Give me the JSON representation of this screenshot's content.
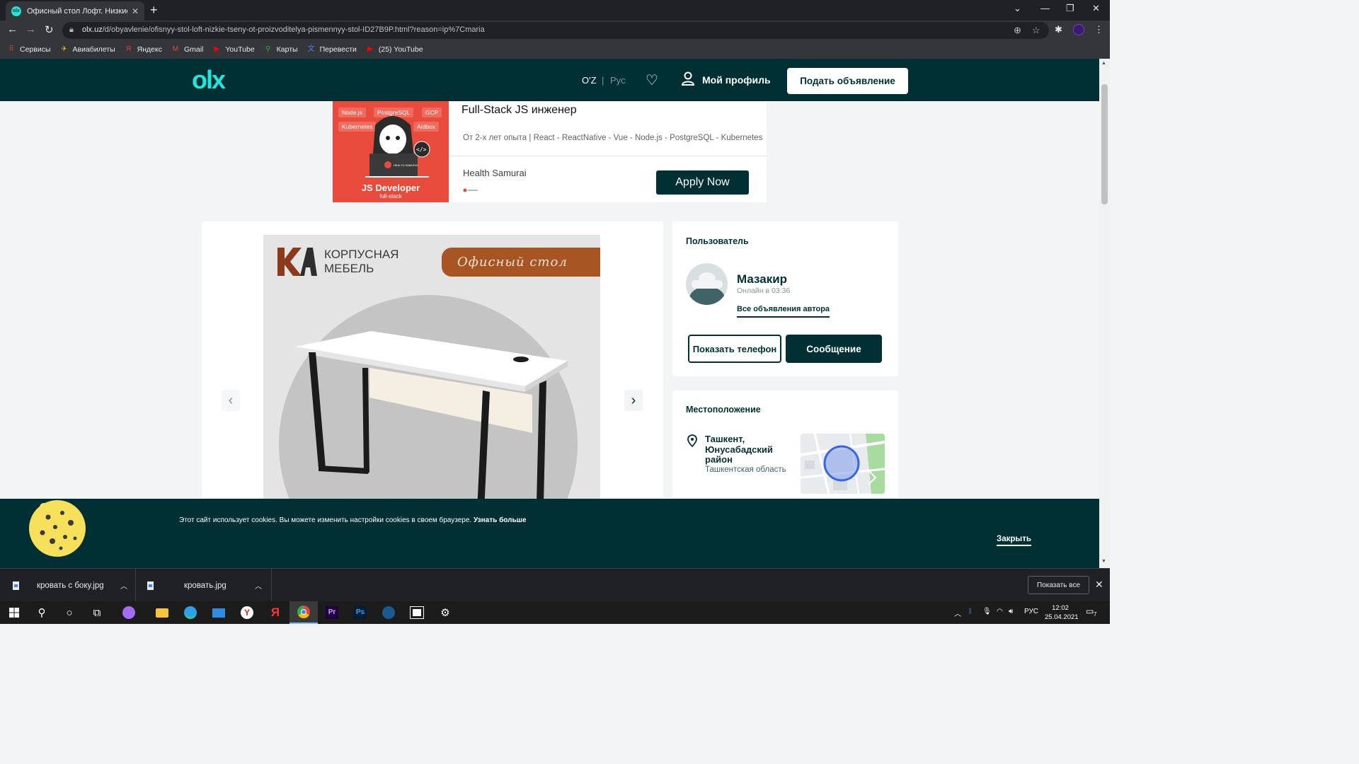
{
  "browser": {
    "tab_title": "Офисный стол Лофт. Низкие це",
    "url_host": "olx.uz",
    "url_path": "/d/obyavlenie/ofisnyy-stol-loft-nizkie-tseny-ot-proizvoditelya-pismennyy-stol-ID27B9P.html?reason=ip%7Cmaria"
  },
  "bookmarks": [
    {
      "label": "Сервисы",
      "icon": "apps-grid-icon",
      "color": "#ea4335"
    },
    {
      "label": "Авиабилеты",
      "icon": "plane-icon",
      "color": "#fbbc04"
    },
    {
      "label": "Яндекс",
      "icon": "yandex-icon",
      "color": "#ff3333"
    },
    {
      "label": "Gmail",
      "icon": "gmail-icon",
      "color": "#ea4335"
    },
    {
      "label": "YouTube",
      "icon": "youtube-icon",
      "color": "#ff0000"
    },
    {
      "label": "Карты",
      "icon": "maps-pin-icon",
      "color": "#34a853"
    },
    {
      "label": "Перевести",
      "icon": "translate-icon",
      "color": "#4285f4"
    },
    {
      "label": "(25) YouTube",
      "icon": "youtube-icon",
      "color": "#ff0000"
    }
  ],
  "header": {
    "logo": "olx",
    "lang_active": "O'Z",
    "lang_sep": "|",
    "lang_inactive": "Рус",
    "profile_label": "Мой профиль",
    "post_button": "Подать объявление"
  },
  "ad": {
    "chips": [
      "Node.js",
      "PostgreSQL",
      "GCP",
      "Kubernetes",
      "Aidbox"
    ],
    "badge_text": "HEALTH SAMURAI",
    "dev_title": "JS Developer",
    "dev_sub": "full-stack",
    "title": "Full-Stack JS инженер",
    "description": "От 2-х лет опыта | React - ReactNative - Vue - Node.js - PostgreSQL - Kubernetes",
    "company": "Health Samurai",
    "cta": "Apply Now"
  },
  "gallery": {
    "brand_line1": "КОРПУСНАЯ",
    "brand_line2": "МЕБЕЛЬ",
    "ribbon": "Офисный стол"
  },
  "user": {
    "heading": "Пользователь",
    "name": "Мазакир",
    "online": "Онлайн в 03:36",
    "all_ads": "Все объявления автора",
    "phone_button": "Показать телефон",
    "message_button": "Сообщение"
  },
  "location": {
    "heading": "Местоположение",
    "city": "Ташкент, Юнусабадский район",
    "region": "Ташкентская область"
  },
  "cookie": {
    "text": "Этот сайт использует cookies. Вы можете изменить настройки cookies в своем браузере.",
    "more": "Узнать больше",
    "close": "Закрыть"
  },
  "downloads": {
    "items": [
      "кровать с боку.jpg",
      "кровать.jpg"
    ],
    "show_all": "Показать все"
  },
  "taskbar": {
    "lang": "РУС",
    "time": "12:02",
    "date": "25.04.2021",
    "notifications": "7"
  }
}
